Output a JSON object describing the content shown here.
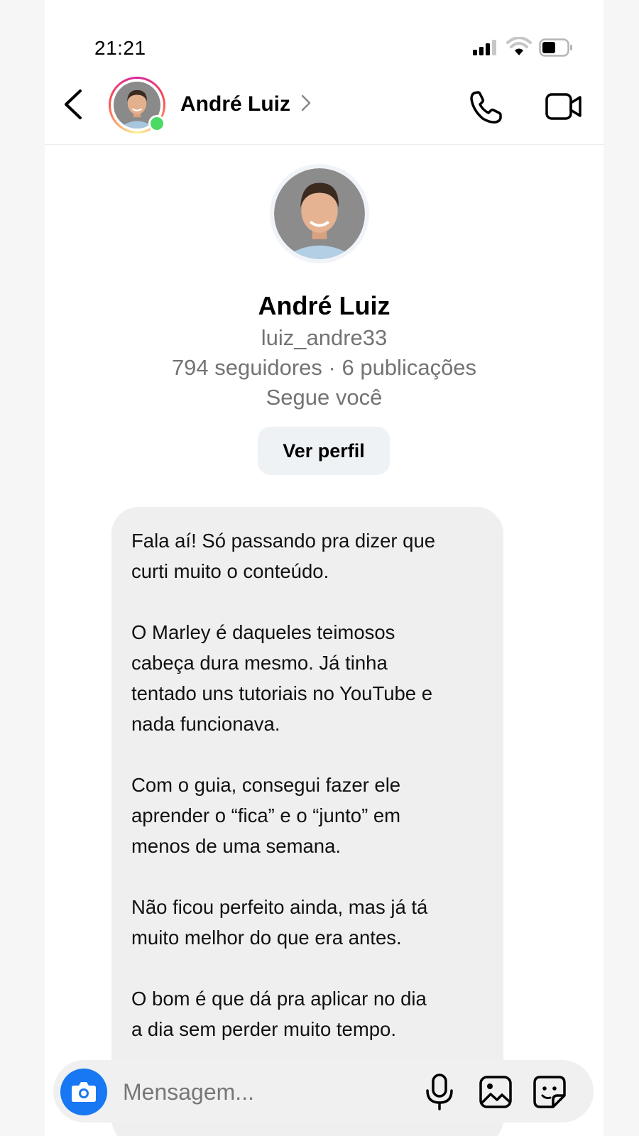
{
  "status_bar": {
    "time": "21:21",
    "battery_level": 0.5
  },
  "header": {
    "name": "André Luiz",
    "online": true,
    "icons": {
      "back": "chevron-left-icon",
      "call": "phone-icon",
      "video": "video-camera-icon"
    }
  },
  "profile": {
    "name": "André Luiz",
    "username": "luiz_andre33",
    "stats": "794 seguidores · 6 publicações",
    "follow_status": "Segue você",
    "view_profile_label": "Ver perfil"
  },
  "message": {
    "paragraphs": [
      "Fala aí! Só passando pra dizer que\ncurti muito o conteúdo.",
      "O Marley é daqueles teimosos\ncabeça dura mesmo. Já tinha\ntentado uns tutoriais no YouTube e\nnada funcionava.",
      "Com o guia, consegui fazer ele\naprender o “fica” e o “junto” em\nmenos de uma semana.",
      "Não ficou perfeito ainda, mas já tá\nmuito melhor do que era antes.",
      "O bom é que dá pra aplicar no dia\na dia sem perder muito tempo."
    ]
  },
  "composer": {
    "placeholder": "Mensagem...",
    "icons": [
      "camera-icon",
      "microphone-icon",
      "image-icon",
      "sticker-icon"
    ],
    "camera_color": "#1877F2"
  },
  "colors": {
    "online": "#4CD964",
    "bubble": "#EFEFEF",
    "secondary_text": "#737373"
  }
}
